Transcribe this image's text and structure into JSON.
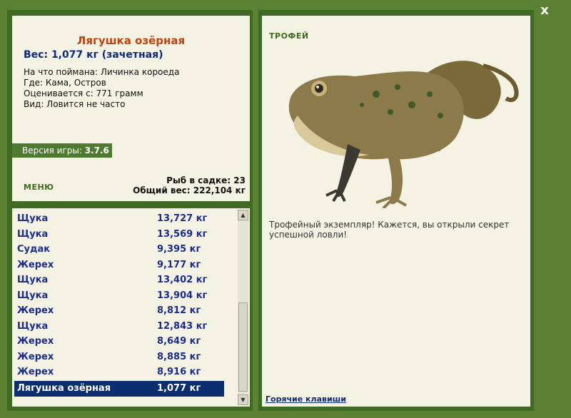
{
  "close_label": "x",
  "info": {
    "title": "Лягушка озёрная",
    "weight": "Вес: 1,077 кг (зачетная)",
    "lines": [
      "На что поймана: Личинка короеда",
      "Где: Кама, Остров",
      "Оценивается с: 771 грамм",
      "Вид: Ловится не часто"
    ],
    "version_label": "Версия игры:",
    "version_value": "3.7.6",
    "menu_label": "МЕНЮ",
    "fish_count": "Рыб в садке: 23",
    "total_weight": "Общий вес: 222,104 кг"
  },
  "catch_list": [
    {
      "name": "Щука",
      "weight": "13,727 кг"
    },
    {
      "name": "Щука",
      "weight": "13,569 кг"
    },
    {
      "name": "Судак",
      "weight": "9,395 кг"
    },
    {
      "name": "Жерех",
      "weight": "9,177 кг"
    },
    {
      "name": "Щука",
      "weight": "13,402 кг"
    },
    {
      "name": "Щука",
      "weight": "13,904 кг"
    },
    {
      "name": "Жерех",
      "weight": "8,812 кг"
    },
    {
      "name": "Щука",
      "weight": "12,843 кг"
    },
    {
      "name": "Жерех",
      "weight": "8,649 кг"
    },
    {
      "name": "Жерех",
      "weight": "8,885 кг"
    },
    {
      "name": "Жерех",
      "weight": "8,916 кг"
    },
    {
      "name": "Лягушка озёрная",
      "weight": "1,077 кг",
      "selected": true
    }
  ],
  "trophy": {
    "label": "ТРОФЕЙ",
    "text": "Трофейный экземпляр! Кажется, вы открыли секрет успешной ловли!",
    "hotkeys": "Горячие клавиши",
    "image_icon": "frog-image"
  },
  "colors": {
    "background": "#5a8232",
    "panel": "#f4f2e2",
    "title": "#c0420d",
    "accent_blue": "#0e2a7a",
    "selection": "#0b2f6e"
  }
}
